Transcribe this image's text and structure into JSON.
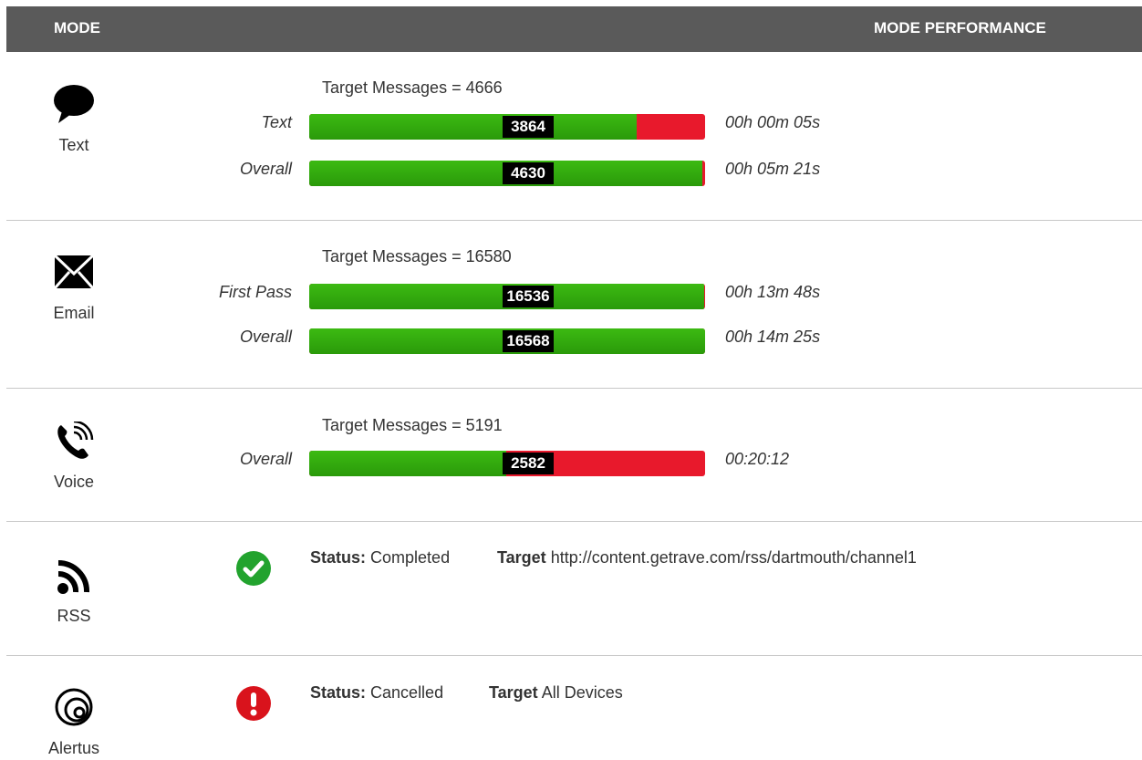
{
  "header": {
    "mode": "MODE",
    "performance": "MODE PERFORMANCE"
  },
  "colors": {
    "header_bg": "#5a5a5a",
    "bar_green": "#2fa80d",
    "bar_red": "#e8192c",
    "success": "#22a32e",
    "error": "#d9131c"
  },
  "modes": {
    "text": {
      "label": "Text",
      "icon": "speech-bubble-icon",
      "target": "Target Messages = 4666",
      "rows": [
        {
          "label": "Text",
          "value": "3864",
          "progress": 0.828,
          "time": "00h 00m 05s"
        },
        {
          "label": "Overall",
          "value": "4630",
          "progress": 0.992,
          "time": "00h 05m 21s"
        }
      ]
    },
    "email": {
      "label": "Email",
      "icon": "envelope-icon",
      "target": "Target Messages = 16580",
      "rows": [
        {
          "label": "First Pass",
          "value": "16536",
          "progress": 0.997,
          "time": "00h 13m 48s"
        },
        {
          "label": "Overall",
          "value": "16568",
          "progress": 0.999,
          "time": "00h 14m 25s"
        }
      ]
    },
    "voice": {
      "label": "Voice",
      "icon": "phone-icon",
      "target": "Target Messages = 5191",
      "rows": [
        {
          "label": "Overall",
          "value": "2582",
          "progress": 0.497,
          "time": "00:20:12"
        }
      ]
    },
    "rss": {
      "label": "RSS",
      "icon": "rss-icon",
      "status_icon": "check-circle-icon",
      "status_label": "Status:",
      "status_value": "Completed",
      "target_label": "Target",
      "target_value": "http://content.getrave.com/rss/dartmouth/channel1"
    },
    "alertus": {
      "label": "Alertus",
      "icon": "alertus-icon",
      "status_icon": "exclamation-circle-icon",
      "status_label": "Status:",
      "status_value": "Cancelled",
      "target_label": "Target",
      "target_value": "All Devices"
    }
  }
}
